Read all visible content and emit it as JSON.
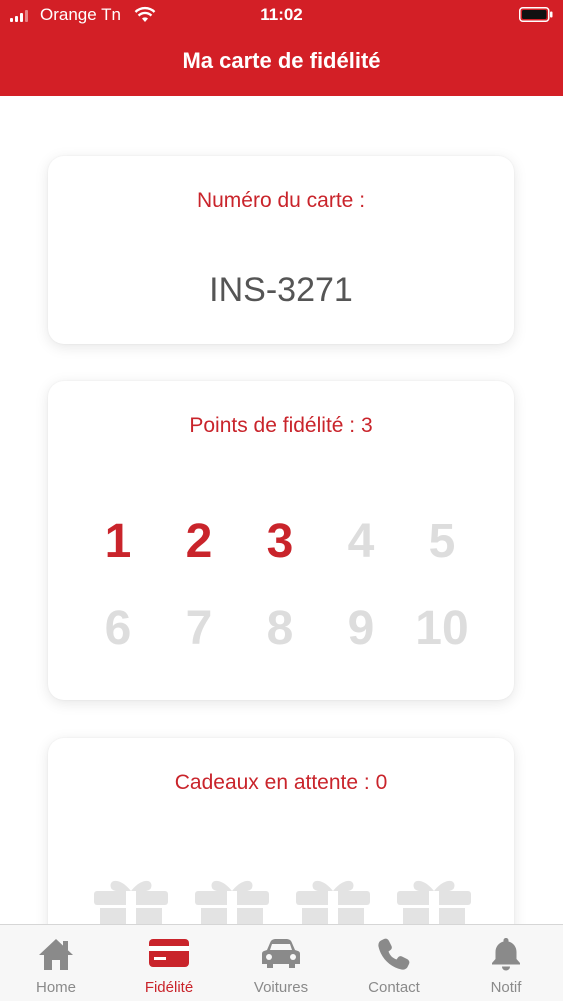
{
  "status_bar": {
    "carrier": "Orange Tn",
    "time": "11:02"
  },
  "header": {
    "title": "Ma carte de fidélité"
  },
  "card_number": {
    "label": "Numéro du carte :",
    "value": "INS-3271"
  },
  "loyalty": {
    "label": "Points de fidélité : 3",
    "earned": 3,
    "total": 10,
    "points": [
      "1",
      "2",
      "3",
      "4",
      "5",
      "6",
      "7",
      "8",
      "9",
      "10"
    ],
    "active_color": "#c9242b",
    "inactive_color": "#dddddd"
  },
  "gifts": {
    "label": "Cadeaux en attente : 0",
    "icon": "gift-icon"
  },
  "tabbar": {
    "items": [
      {
        "label": "Home",
        "icon": "home-icon"
      },
      {
        "label": "Fidélité",
        "icon": "card-icon",
        "active": true
      },
      {
        "label": "Voitures",
        "icon": "car-icon"
      },
      {
        "label": "Contact",
        "icon": "phone-icon"
      },
      {
        "label": "Notif",
        "icon": "bell-icon"
      }
    ]
  },
  "colors": {
    "brand": "#d31f26",
    "accent": "#c9242b"
  }
}
